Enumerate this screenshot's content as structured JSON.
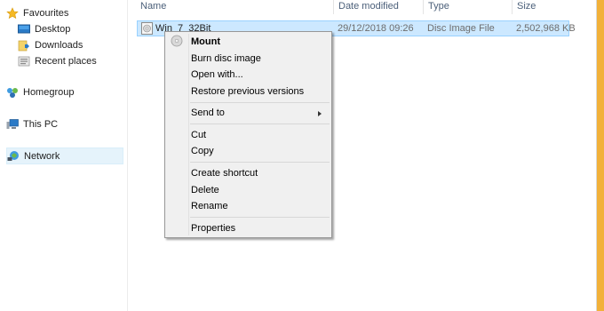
{
  "nav": {
    "favourites": "Favourites",
    "desktop": "Desktop",
    "downloads": "Downloads",
    "recent_places": "Recent places",
    "homegroup": "Homegroup",
    "this_pc": "This PC",
    "network": "Network"
  },
  "columns": {
    "name": "Name",
    "date_modified": "Date modified",
    "type": "Type",
    "size": "Size"
  },
  "file": {
    "name": "Win_7_32Bit",
    "date_modified": "29/12/2018 09:26",
    "type": "Disc Image File",
    "size": "2,502,968 KB"
  },
  "context_menu": {
    "mount": "Mount",
    "burn": "Burn disc image",
    "open_with": "Open with...",
    "restore": "Restore previous versions",
    "send_to": "Send to",
    "cut": "Cut",
    "copy": "Copy",
    "create_shortcut": "Create shortcut",
    "delete": "Delete",
    "rename": "Rename",
    "properties": "Properties"
  },
  "colors": {
    "selection": "#cce8ff",
    "window_frame": "#f2b13a"
  }
}
